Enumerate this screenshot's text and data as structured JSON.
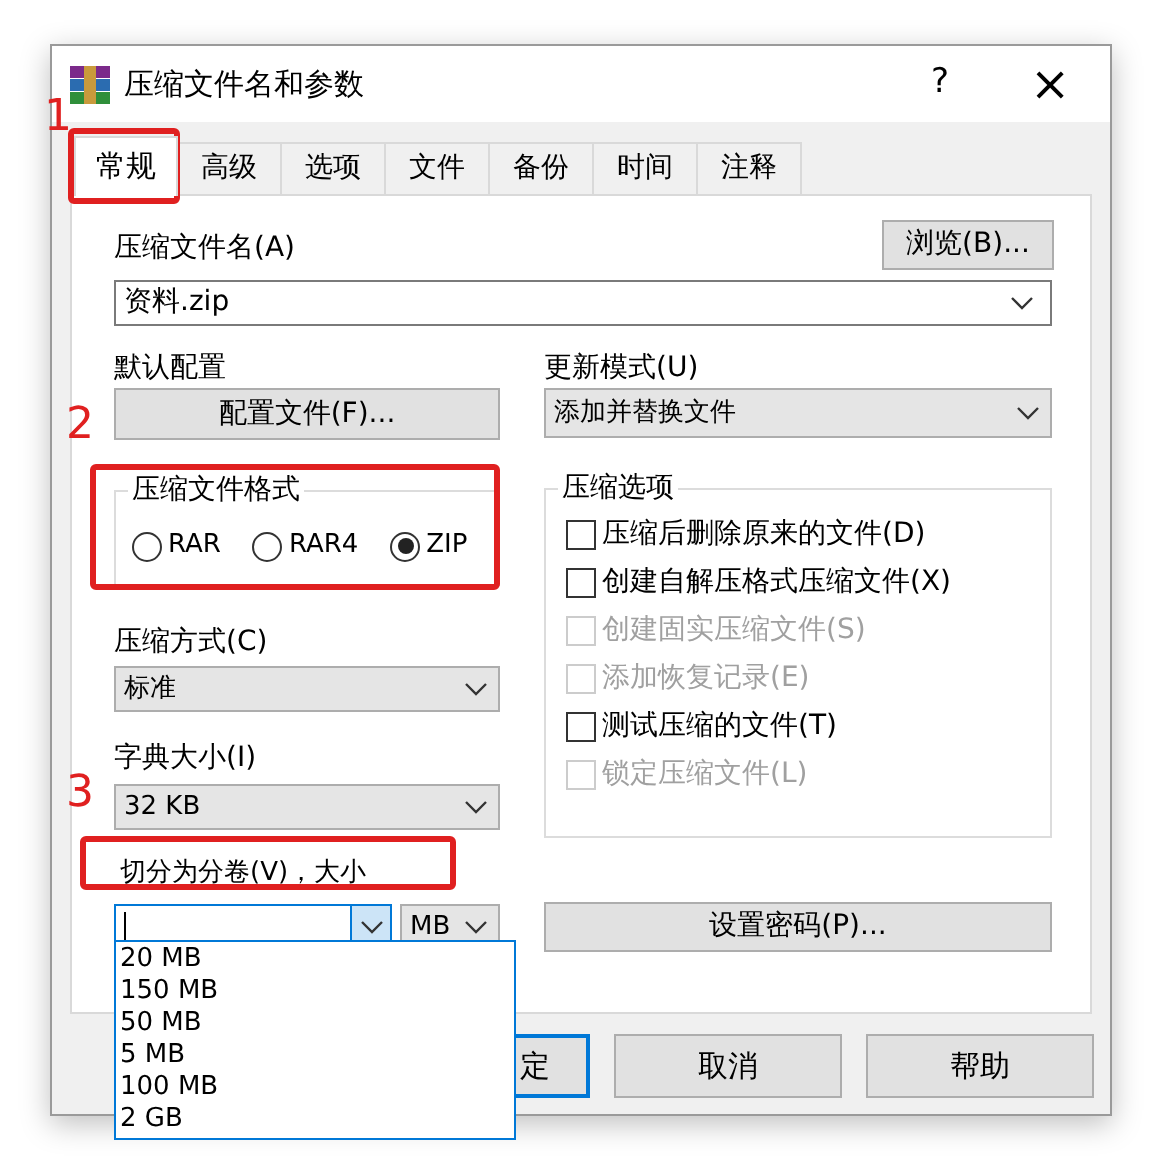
{
  "window": {
    "title": "压缩文件名和参数",
    "help": "?",
    "close": "×"
  },
  "tabs": [
    {
      "label": "常规",
      "selected": true
    },
    {
      "label": "高级",
      "selected": false
    },
    {
      "label": "选项",
      "selected": false
    },
    {
      "label": "文件",
      "selected": false
    },
    {
      "label": "备份",
      "selected": false
    },
    {
      "label": "时间",
      "selected": false
    },
    {
      "label": "注释",
      "selected": false
    }
  ],
  "archive_name": {
    "label": "压缩文件名(A)",
    "value": "资料.zip",
    "browse": "浏览(B)..."
  },
  "default_profile": {
    "label": "默认配置",
    "button": "配置文件(F)..."
  },
  "update_mode": {
    "label": "更新模式(U)",
    "value": "添加并替换文件"
  },
  "archive_format": {
    "title": "压缩文件格式",
    "options": [
      {
        "label": "RAR",
        "selected": false
      },
      {
        "label": "RAR4",
        "selected": false
      },
      {
        "label": "ZIP",
        "selected": true
      }
    ]
  },
  "compression_method": {
    "label": "压缩方式(C)",
    "value": "标准"
  },
  "dictionary_size": {
    "label": "字典大小(I)",
    "value": "32 KB"
  },
  "split_volumes": {
    "label": "切分为分卷(V)，大小",
    "unit": "MB",
    "expanded": true,
    "options": [
      "20 MB",
      "150 MB",
      "50 MB",
      "5 MB",
      "100 MB",
      "2 GB"
    ]
  },
  "compression_options": {
    "title": "压缩选项",
    "items": [
      {
        "label": "压缩后删除原来的文件(D)",
        "checked": false,
        "disabled": false
      },
      {
        "label": "创建自解压格式压缩文件(X)",
        "checked": false,
        "disabled": false
      },
      {
        "label": "创建固实压缩文件(S)",
        "checked": false,
        "disabled": true
      },
      {
        "label": "添加恢复记录(E)",
        "checked": false,
        "disabled": true
      },
      {
        "label": "测试压缩的文件(T)",
        "checked": false,
        "disabled": false
      },
      {
        "label": "锁定压缩文件(L)",
        "checked": false,
        "disabled": true
      }
    ]
  },
  "set_password": "设置密码(P)...",
  "buttons": [
    {
      "label": "定",
      "default": true
    },
    {
      "label": "取消",
      "default": false
    },
    {
      "label": "帮助",
      "default": false
    }
  ],
  "annotations": [
    {
      "label": "1"
    },
    {
      "label": "2"
    },
    {
      "label": "3"
    }
  ]
}
